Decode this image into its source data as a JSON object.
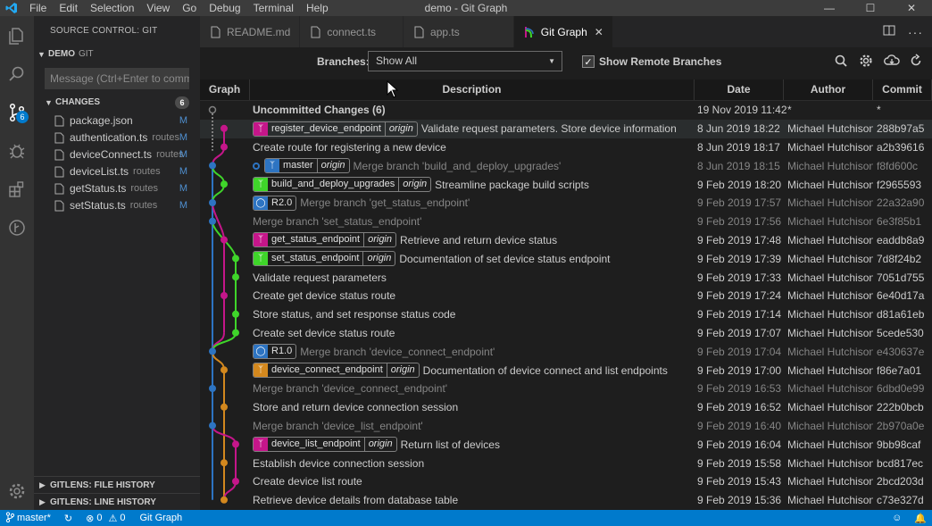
{
  "window": {
    "title": "demo - Git Graph",
    "menu": [
      "File",
      "Edit",
      "Selection",
      "View",
      "Go",
      "Debug",
      "Terminal",
      "Help"
    ]
  },
  "activity": {
    "scm_badge": "6"
  },
  "sidebar": {
    "header": "SOURCE CONTROL: GIT",
    "repo": {
      "name": "DEMO",
      "provider": "GIT"
    },
    "commit_placeholder": "Message (Ctrl+Enter to commit",
    "changes": {
      "label": "CHANGES",
      "count": "6"
    },
    "files": [
      {
        "name": "package.json",
        "dir": "",
        "status": "M"
      },
      {
        "name": "authentication.ts",
        "dir": "routes",
        "status": "M"
      },
      {
        "name": "deviceConnect.ts",
        "dir": "routes",
        "status": "M"
      },
      {
        "name": "deviceList.ts",
        "dir": "routes",
        "status": "M"
      },
      {
        "name": "getStatus.ts",
        "dir": "routes",
        "status": "M"
      },
      {
        "name": "setStatus.ts",
        "dir": "routes",
        "status": "M"
      }
    ],
    "bottom_sections": [
      "GITLENS: FILE HISTORY",
      "GITLENS: LINE HISTORY"
    ]
  },
  "tabs": [
    {
      "label": "README.md",
      "active": false
    },
    {
      "label": "connect.ts",
      "active": false
    },
    {
      "label": "app.ts",
      "active": false
    },
    {
      "label": "Git Graph",
      "active": true
    }
  ],
  "gitgraph": {
    "branches_label": "Branches:",
    "branches_value": "Show All",
    "show_remote_label": "Show Remote Branches",
    "show_remote_checked": true,
    "columns": [
      "Graph",
      "Description",
      "Date",
      "Author",
      "Commit"
    ],
    "rows": [
      {
        "desc": "Uncommitted Changes (6)",
        "date": "19 Nov 2019 11:42",
        "author": "*",
        "commit": "*"
      },
      {
        "desc": "Validate request parameters. Store device information",
        "date": "8 Jun 2019 18:22",
        "author": "Michael Hutchison",
        "commit": "288b97a5",
        "ref": "register_device_endpoint",
        "remote": "origin"
      },
      {
        "desc": "Create route for registering a new device",
        "date": "8 Jun 2019 18:17",
        "author": "Michael Hutchison",
        "commit": "a2b39616"
      },
      {
        "desc": "Merge branch 'build_and_deploy_upgrades'",
        "date": "8 Jun 2019 18:15",
        "author": "Michael Hutchison",
        "commit": "f8fd600c",
        "ref": "master",
        "remote": "origin"
      },
      {
        "desc": "Streamline package build scripts",
        "date": "9 Feb 2019 18:20",
        "author": "Michael Hutchison",
        "commit": "f2965593",
        "ref": "build_and_deploy_upgrades",
        "remote": "origin"
      },
      {
        "desc": "Merge branch 'get_status_endpoint'",
        "date": "9 Feb 2019 17:57",
        "author": "Michael Hutchison",
        "commit": "22a32a90",
        "tag": "R2.0"
      },
      {
        "desc": "Merge branch 'set_status_endpoint'",
        "date": "9 Feb 2019 17:56",
        "author": "Michael Hutchison",
        "commit": "6e3f85b1"
      },
      {
        "desc": "Retrieve and return device status",
        "date": "9 Feb 2019 17:48",
        "author": "Michael Hutchison",
        "commit": "eaddb8a9",
        "ref": "get_status_endpoint",
        "remote": "origin"
      },
      {
        "desc": "Documentation of set device status endpoint",
        "date": "9 Feb 2019 17:39",
        "author": "Michael Hutchison",
        "commit": "7d8f24b2",
        "ref": "set_status_endpoint",
        "remote": "origin"
      },
      {
        "desc": "Validate request parameters",
        "date": "9 Feb 2019 17:33",
        "author": "Michael Hutchison",
        "commit": "7051d755"
      },
      {
        "desc": "Create get device status route",
        "date": "9 Feb 2019 17:24",
        "author": "Michael Hutchison",
        "commit": "6e40d17a"
      },
      {
        "desc": "Store status, and set response status code",
        "date": "9 Feb 2019 17:14",
        "author": "Michael Hutchison",
        "commit": "d81a61eb"
      },
      {
        "desc": "Create set device status route",
        "date": "9 Feb 2019 17:07",
        "author": "Michael Hutchison",
        "commit": "5cede530"
      },
      {
        "desc": "Merge branch 'device_connect_endpoint'",
        "date": "9 Feb 2019 17:04",
        "author": "Michael Hutchison",
        "commit": "e430637e",
        "tag": "R1.0"
      },
      {
        "desc": "Documentation of device connect and list endpoints",
        "date": "9 Feb 2019 17:00",
        "author": "Michael Hutchison",
        "commit": "f86e7a01",
        "ref": "device_connect_endpoint",
        "remote": "origin"
      },
      {
        "desc": "Merge branch 'device_connect_endpoint'",
        "date": "9 Feb 2019 16:53",
        "author": "Michael Hutchison",
        "commit": "6dbd0e99"
      },
      {
        "desc": "Store and return device connection session",
        "date": "9 Feb 2019 16:52",
        "author": "Michael Hutchison",
        "commit": "222b0bcb"
      },
      {
        "desc": "Merge branch 'device_list_endpoint'",
        "date": "9 Feb 2019 16:40",
        "author": "Michael Hutchison",
        "commit": "2b970a0e"
      },
      {
        "desc": "Return list of devices",
        "date": "9 Feb 2019 16:04",
        "author": "Michael Hutchison",
        "commit": "9bb98caf",
        "ref": "device_list_endpoint",
        "remote": "origin"
      },
      {
        "desc": "Establish device connection session",
        "date": "9 Feb 2019 15:58",
        "author": "Michael Hutchison",
        "commit": "bcd817ec"
      },
      {
        "desc": "Create device list route",
        "date": "9 Feb 2019 15:43",
        "author": "Michael Hutchison",
        "commit": "2bcd203d"
      },
      {
        "desc": "Retrieve device details from database table",
        "date": "9 Feb 2019 15:36",
        "author": "Michael Hutchison",
        "commit": "c73e327d"
      }
    ]
  },
  "statusbar": {
    "branch": "master*",
    "errors": "0",
    "warnings": "0",
    "git_graph": "Git Graph"
  },
  "colors": {
    "accent": "#007acc",
    "magenta": "#c5168a",
    "green": "#3fd52a",
    "blue": "#2d74c2",
    "orange": "#d3881e",
    "gray": "#808080"
  }
}
